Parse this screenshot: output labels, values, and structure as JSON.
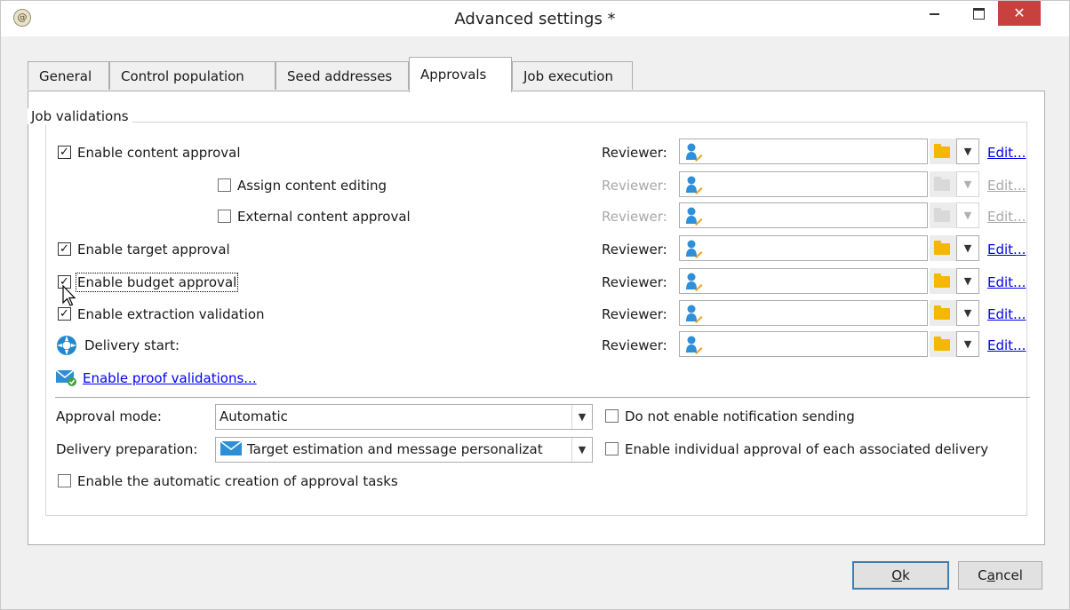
{
  "window": {
    "title": "Advanced settings *",
    "app_icon_glyph": "@",
    "minimize_glyph": "",
    "close_glyph": "✕"
  },
  "tabs": [
    {
      "label": "General",
      "active": false
    },
    {
      "label": "Control population",
      "active": false
    },
    {
      "label": "Seed addresses",
      "active": false
    },
    {
      "label": "Approvals",
      "active": true
    },
    {
      "label": "Job execution",
      "active": false
    }
  ],
  "job_validations": {
    "group_label": "Job validations",
    "reviewer_label": "Reviewer:",
    "edit_label": "Edit...",
    "rows": [
      {
        "label": "Enable content approval",
        "checked": true,
        "enabled": true
      },
      {
        "label": "Assign content editing",
        "checked": false,
        "enabled": false
      },
      {
        "label": "External content approval",
        "checked": false,
        "enabled": false
      },
      {
        "label": "Enable target approval",
        "checked": true,
        "enabled": true
      },
      {
        "label": "Enable budget approval",
        "checked": true,
        "enabled": true
      },
      {
        "label": "Enable extraction validation",
        "checked": true,
        "enabled": true
      },
      {
        "label": "Delivery start:",
        "checked": null,
        "enabled": true
      }
    ],
    "proof_link": "Enable proof validations..."
  },
  "approval": {
    "mode_label": "Approval mode:",
    "mode_value": "Automatic",
    "prep_label": "Delivery preparation:",
    "prep_value": "Target estimation and message personalizat",
    "no_notification_label": "Do not enable notification sending",
    "no_notification_checked": false,
    "individual_approval_label": "Enable individual approval of each associated delivery",
    "individual_approval_checked": false,
    "auto_tasks_label": "Enable the automatic creation of approval tasks",
    "auto_tasks_checked": false
  },
  "buttons": {
    "ok_label": "k",
    "ok_mnemonic": "O",
    "cancel_label_pre": "C",
    "cancel_mnemonic": "a",
    "cancel_label_post": "ncel"
  },
  "colors": {
    "close_button": "#c7413f",
    "link": "#0000ee",
    "folder": "#f5b800",
    "default_button_border": "#3c7fb1"
  }
}
